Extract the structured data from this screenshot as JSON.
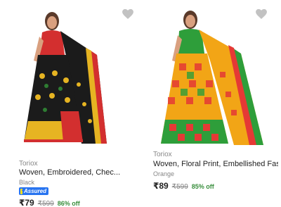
{
  "products": [
    {
      "brand": "Toriox",
      "title": "Woven, Embroidered, Chec...",
      "variant": "Black",
      "assured": "Assured",
      "price": "₹79",
      "mrp": "₹599",
      "discount": "86% off",
      "colors": {
        "body": "#1b1b1b",
        "border": "#d32f2f",
        "accent": "#e6b422"
      }
    },
    {
      "brand": "Toriox",
      "title": "Woven, Floral Print, Embellished Fashion ...",
      "variant": "Orange",
      "price": "₹89",
      "mrp": "₹599",
      "discount": "85% off",
      "colors": {
        "body": "#f2a516",
        "border": "#2e9e3a",
        "accent": "#e53935"
      }
    }
  ],
  "icons": {
    "wishlist": "heart-icon",
    "assured": "f-assured-icon"
  }
}
